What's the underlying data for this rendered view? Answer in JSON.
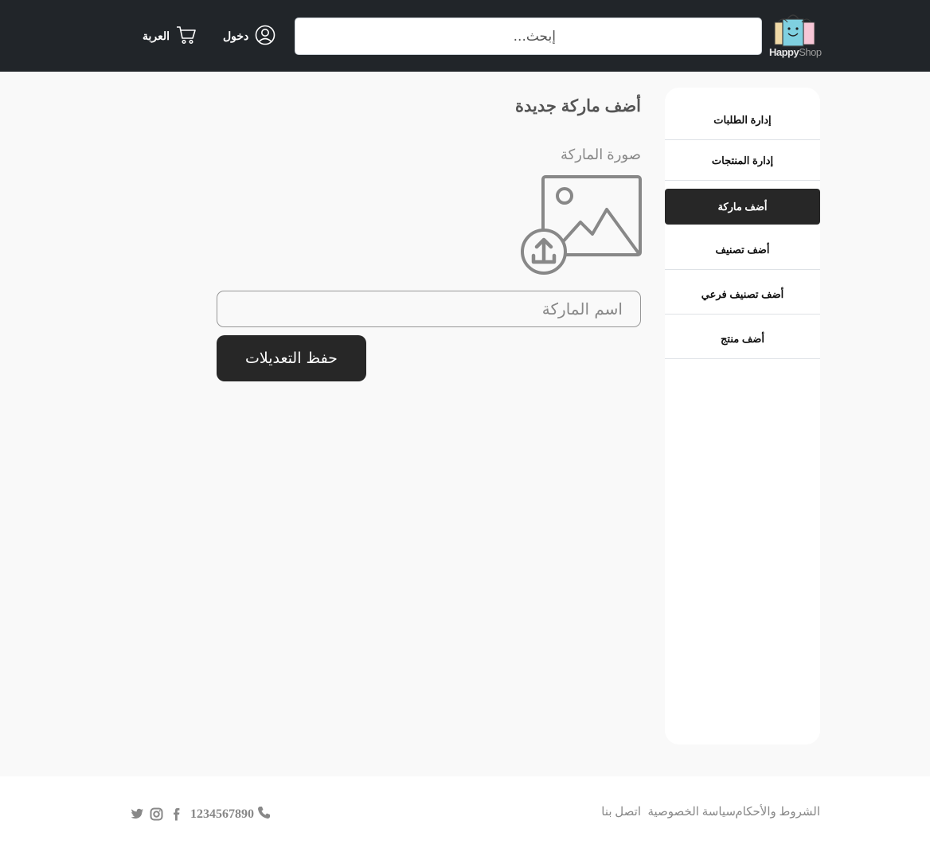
{
  "header": {
    "logo": {
      "text_primary": "Happy",
      "text_secondary": "Shop",
      "icon": "shopping-bags-logo"
    },
    "search_placeholder": "إبحث...",
    "login_label": "دخول",
    "cart_label": "العربة",
    "login_icon": "user-circle-icon",
    "cart_icon": "cart-icon"
  },
  "sidebar": {
    "items": [
      {
        "label": "إدارة الطلبات",
        "active": false
      },
      {
        "label": "إدارة المنتجات",
        "active": false
      },
      {
        "label": "أضف ماركة",
        "active": true
      },
      {
        "label": "أضف تصنيف",
        "active": false
      },
      {
        "label": "أضف تصنيف فرعي",
        "active": false
      },
      {
        "label": "أضف منتج",
        "active": false
      }
    ]
  },
  "main": {
    "title": "أضف ماركة جديدة",
    "image_label": "صورة الماركة",
    "upload_icon": "image-upload-icon",
    "name_placeholder": "اسم الماركة",
    "save_label": "حفظ التعديلات"
  },
  "footer": {
    "links": [
      "الشروط والأحكام",
      "سياسة الخصوصية",
      "اتصل بنا"
    ],
    "phone": "1234567890",
    "social_icons": [
      "facebook-icon",
      "instagram-icon",
      "twitter-icon"
    ]
  },
  "colors": {
    "navbar": "#212529",
    "accent_dark": "#272727",
    "muted_text": "#888888",
    "page_bg": "#f9f9f9"
  }
}
